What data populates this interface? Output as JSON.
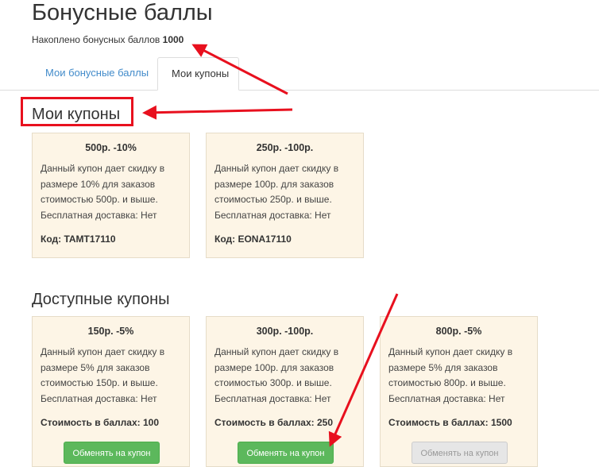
{
  "page": {
    "title": "Бонусные баллы",
    "points_label": "Накоплено бонусных баллов",
    "points_value": "1000"
  },
  "tabs": [
    {
      "label": "Мои бонусные баллы",
      "active": false
    },
    {
      "label": "Мои купоны",
      "active": true
    }
  ],
  "my_coupons": {
    "heading": "Мои купоны",
    "items": [
      {
        "title": "500р. -10%",
        "desc": [
          "Данный купон дает скидку в",
          "размере 10% для заказов",
          "стоимостью 500р. и выше.",
          "Бесплатная доставка: Нет"
        ],
        "code": "Код: TAMT17110"
      },
      {
        "title": "250р. -100р.",
        "desc": [
          "Данный купон дает скидку в",
          "размере 100р. для заказов",
          "стоимостью 250р. и выше.",
          "Бесплатная доставка: Нет"
        ],
        "code": "Код: EONA17110"
      }
    ]
  },
  "available_coupons": {
    "heading": "Доступные купоны",
    "items": [
      {
        "title": "150р. -5%",
        "desc": [
          "Данный купон дает скидку в",
          "размере 5% для заказов",
          "стоимостью 150р. и выше.",
          "Бесплатная доставка: Нет"
        ],
        "cost": "Стоимость в баллах: 100",
        "button": "Обменять на купон",
        "enabled": true
      },
      {
        "title": "300р. -100р.",
        "desc": [
          "Данный купон дает скидку в",
          "размере 100р. для заказов",
          "стоимостью 300р. и выше.",
          "Бесплатная доставка: Нет"
        ],
        "cost": "Стоимость в баллах: 250",
        "button": "Обменять на купон",
        "enabled": true
      },
      {
        "title": "800р. -5%",
        "desc": [
          "Данный купон дает скидку в",
          "размере 5% для заказов",
          "стоимостью 800р. и выше.",
          "Бесплатная доставка: Нет"
        ],
        "cost": "Стоимость в баллах: 1500",
        "button": "Обменять на купон",
        "enabled": false
      }
    ]
  },
  "colors": {
    "annotation": "#e8101e",
    "link": "#428bca",
    "card_bg": "#fdf5e6",
    "button_green": "#5cb85c",
    "button_disabled": "#e6e6e6"
  }
}
